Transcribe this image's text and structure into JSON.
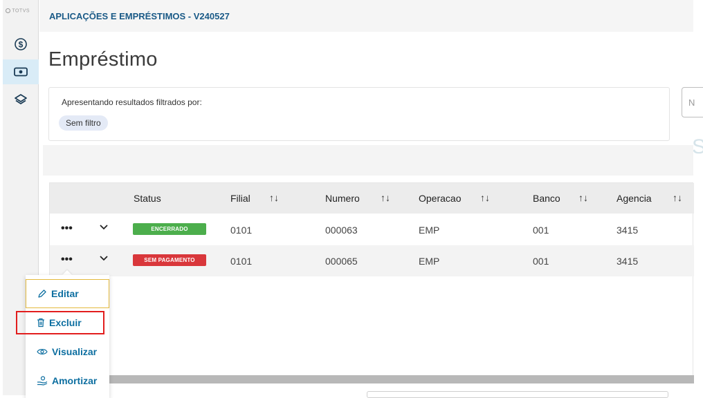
{
  "brand": "TOTVS",
  "app_title": "APLICAÇÕES E EMPRÉSTIMOS - V240527",
  "page_title": "Empréstimo",
  "filter": {
    "label": "Apresentando resultados filtrados por:",
    "chip": "Sem filtro"
  },
  "search": {
    "placeholder_partial": "N"
  },
  "right_partial_text": "S",
  "sidebar": {
    "items": [
      {
        "icon": "dollar-circle-icon",
        "active": false
      },
      {
        "icon": "cash-icon",
        "active": true
      },
      {
        "icon": "layers-icon",
        "active": false
      }
    ]
  },
  "table": {
    "columns": [
      "Status",
      "Filial",
      "Numero",
      "Operacao",
      "Banco",
      "Agencia"
    ],
    "sort_glyph": "↑↓",
    "rows": [
      {
        "actions": "•••",
        "status": "ENCERRADO",
        "status_color": "#4cae4c",
        "filial": "0101",
        "numero": "000063",
        "operacao": "EMP",
        "banco": "001",
        "agencia": "3415"
      },
      {
        "actions": "•••",
        "status": "SEM PAGAMENTO",
        "status_color": "#d9373b",
        "filial": "0101",
        "numero": "000065",
        "operacao": "EMP",
        "banco": "001",
        "agencia": "3415"
      }
    ]
  },
  "context_menu": {
    "items": [
      {
        "label": "Editar",
        "icon": "pencil-icon"
      },
      {
        "label": "Excluir",
        "icon": "trash-icon"
      },
      {
        "label": "Visualizar",
        "icon": "eye-icon"
      },
      {
        "label": "Amortizar",
        "icon": "hand-coins-icon"
      }
    ],
    "highlight_color": "#e21d1d"
  }
}
